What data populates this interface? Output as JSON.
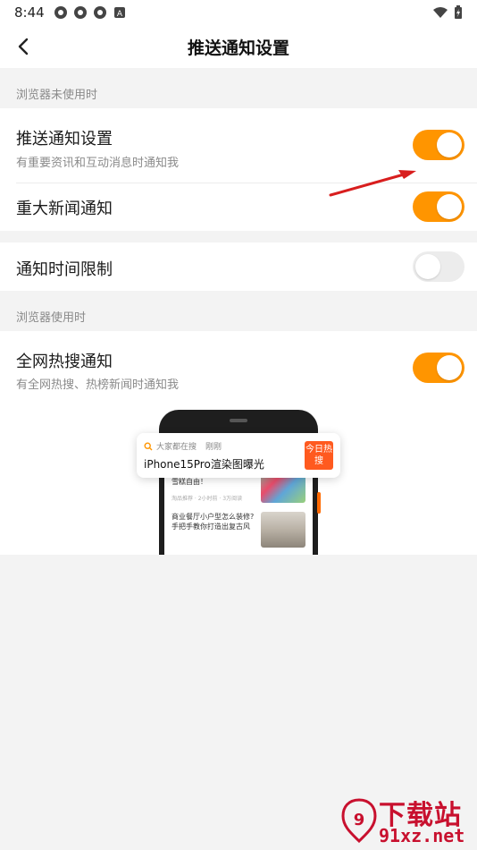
{
  "status_bar": {
    "time": "8:44",
    "icons": [
      "app-notification-icon",
      "app-notification-icon",
      "app-notification-icon",
      "accessibility-a-icon",
      "wifi-icon",
      "battery-charging-icon"
    ]
  },
  "header": {
    "title": "推送通知设置",
    "back_icon": "chevron-left-icon"
  },
  "sections": {
    "unused_label": "浏览器未使用时",
    "used_label": "浏览器使用时"
  },
  "settings": {
    "push": {
      "label": "推送通知设置",
      "sub": "有重要资讯和互动消息时通知我",
      "enabled": true
    },
    "major_news": {
      "label": "重大新闻通知",
      "enabled": true
    },
    "time_limit": {
      "label": "通知时间限制",
      "enabled": false
    },
    "hot_search": {
      "label": "全网热搜通知",
      "sub": "有全网热搜、热榜新闻时通知我",
      "enabled": true
    }
  },
  "illustration": {
    "notification": {
      "source": "大家都在搜",
      "time": "刚刚",
      "title": "iPhone15Pro渲染图曝光",
      "badge": "今日热搜"
    },
    "feed": [
      {
        "title": "夏天报到“雪糕刺客”，实现雪糕自由！",
        "meta": "淘品推荐 · 2小时前 · 3万阅读"
      },
      {
        "title": "商业餐厅小户型怎么装修?手把手教你打造出复古风",
        "meta": ""
      }
    ]
  },
  "colors": {
    "accent": "#ff9500",
    "toggle_off": "#ececec",
    "badge": "#ff5a1f",
    "annotation_arrow": "#d81e1e",
    "watermark": "#c8102e"
  },
  "watermark": {
    "text": "下载站",
    "url": "91xz.net"
  }
}
